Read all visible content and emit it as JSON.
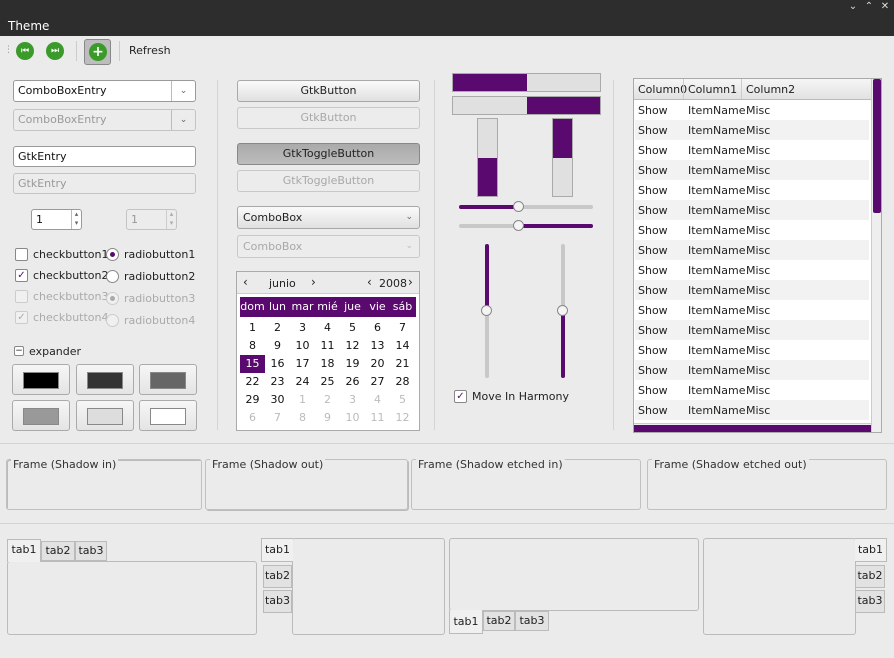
{
  "window": {
    "title": "Theme",
    "controls": [
      "⌄",
      "⌃",
      "✕"
    ]
  },
  "toolbar": {
    "refresh_label": "Refresh"
  },
  "combo_entry": {
    "value": "ComboBoxEntry",
    "disabled_value": "ComboBoxEntry"
  },
  "entry": {
    "value": "GtkEntry",
    "disabled_value": "GtkEntry"
  },
  "spin": {
    "value": "1",
    "disabled_value": "1"
  },
  "checks": [
    {
      "label": "checkbutton1",
      "checked": false
    },
    {
      "label": "checkbutton2",
      "checked": true
    },
    {
      "label": "checkbutton3",
      "checked": false
    },
    {
      "label": "checkbutton4",
      "checked": true
    }
  ],
  "radios": [
    {
      "label": "radiobutton1"
    },
    {
      "label": "radiobutton2"
    },
    {
      "label": "radiobutton3"
    },
    {
      "label": "radiobutton4"
    }
  ],
  "expander": {
    "label": "expander",
    "icon": "minus-icon"
  },
  "swatches": [
    "#000000",
    "#333333",
    "#666666",
    "#999999",
    "#dddddd",
    "#ffffff"
  ],
  "buttons": {
    "button": "GtkButton",
    "button_dis": "GtkButton",
    "toggle": "GtkToggleButton",
    "toggle_dis": "GtkToggleButton",
    "combo": "ComboBox",
    "combo_dis": "ComboBox"
  },
  "calendar": {
    "month": "junio",
    "year": "2008",
    "days": [
      "dom",
      "lun",
      "mar",
      "mié",
      "jue",
      "vie",
      "sáb"
    ],
    "rows": [
      [
        "1",
        "2",
        "3",
        "4",
        "5",
        "6",
        "7"
      ],
      [
        "8",
        "9",
        "10",
        "11",
        "12",
        "13",
        "14"
      ],
      [
        "15",
        "16",
        "17",
        "18",
        "19",
        "20",
        "21"
      ],
      [
        "22",
        "23",
        "24",
        "25",
        "26",
        "27",
        "28"
      ],
      [
        "29",
        "30",
        "1",
        "2",
        "3",
        "4",
        "5"
      ],
      [
        "6",
        "7",
        "8",
        "9",
        "10",
        "11",
        "12"
      ]
    ],
    "selected": "15"
  },
  "progress": {
    "h1": 0.5,
    "h2": 0.5,
    "v1": 0.5,
    "v2": 0.5
  },
  "scales": {
    "h1": 0.45,
    "h2": 0.45,
    "v1": 0.5,
    "v2": 0.5
  },
  "harmony": {
    "label": "Move In Harmony",
    "checked": true
  },
  "tree": {
    "columns": [
      "Column0",
      "Column1",
      "Column2"
    ],
    "rows": [
      [
        "Show",
        "ItemName",
        "Misc"
      ],
      [
        "Show",
        "ItemName",
        "Misc"
      ],
      [
        "Show",
        "ItemName",
        "Misc"
      ],
      [
        "Show",
        "ItemName",
        "Misc"
      ],
      [
        "Show",
        "ItemName",
        "Misc"
      ],
      [
        "Show",
        "ItemName",
        "Misc"
      ],
      [
        "Show",
        "ItemName",
        "Misc"
      ],
      [
        "Show",
        "ItemName",
        "Misc"
      ],
      [
        "Show",
        "ItemName",
        "Misc"
      ],
      [
        "Show",
        "ItemName",
        "Misc"
      ],
      [
        "Show",
        "ItemName",
        "Misc"
      ],
      [
        "Show",
        "ItemName",
        "Misc"
      ],
      [
        "Show",
        "ItemName",
        "Misc"
      ],
      [
        "Show",
        "ItemName",
        "Misc"
      ],
      [
        "Show",
        "ItemName",
        "Misc"
      ],
      [
        "Show",
        "ItemName",
        "Misc"
      ]
    ]
  },
  "frames": [
    "Frame (Shadow in)",
    "Frame (Shadow out)",
    "Frame (Shadow etched in)",
    "Frame (Shadow etched out)"
  ],
  "tabs": [
    "tab1",
    "tab2",
    "tab3"
  ],
  "colors": {
    "accent": "#5a0a6e"
  }
}
